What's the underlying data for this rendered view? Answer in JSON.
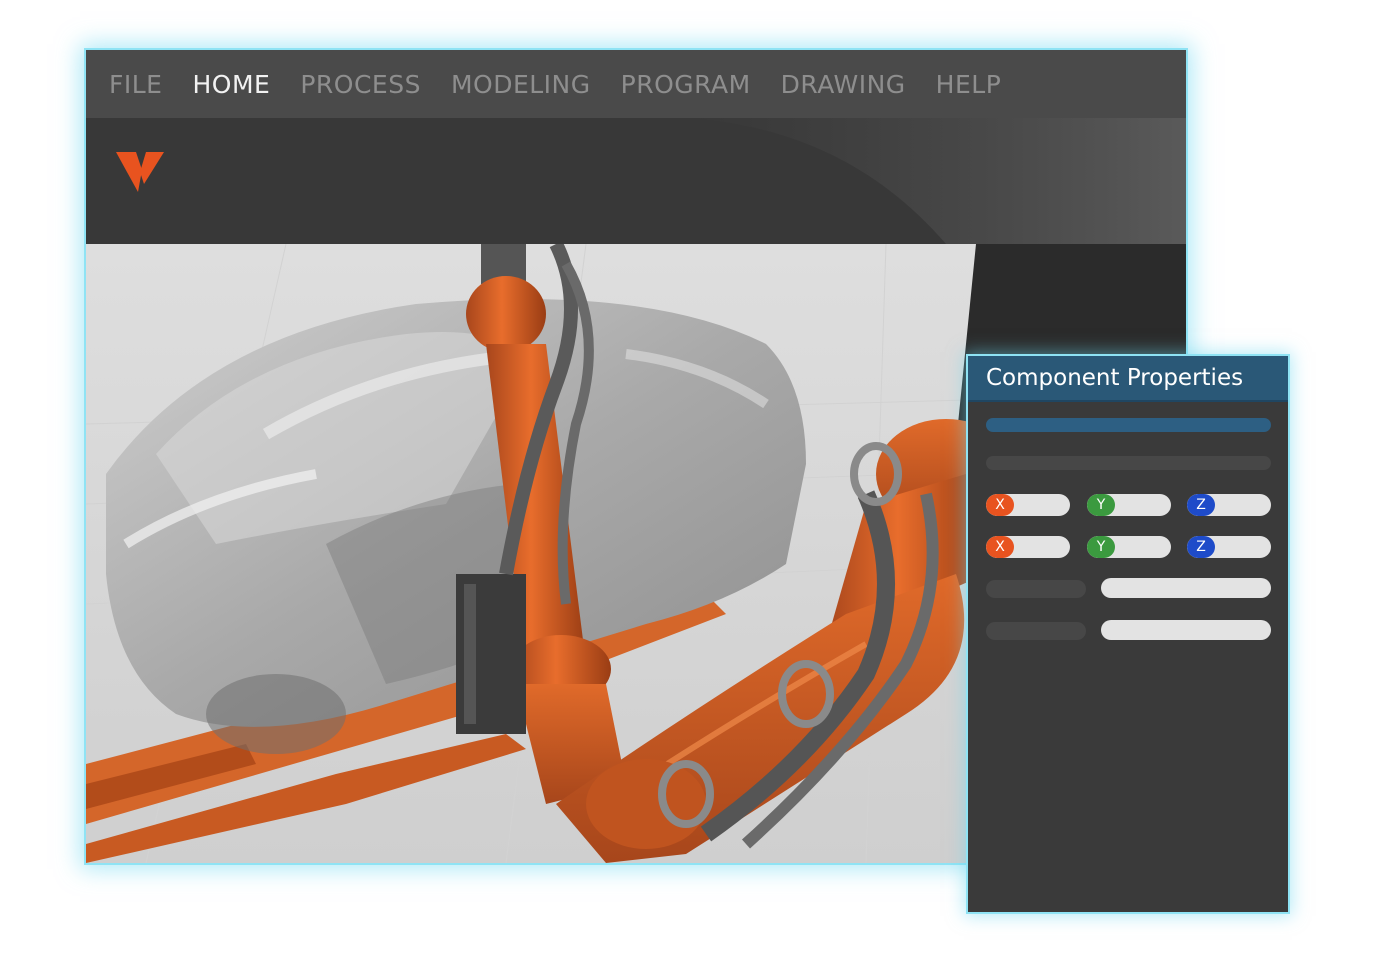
{
  "menu": {
    "items": [
      {
        "label": "FILE"
      },
      {
        "label": "HOME"
      },
      {
        "label": "PROCESS"
      },
      {
        "label": "MODELING"
      },
      {
        "label": "PROGRAM"
      },
      {
        "label": "DRAWING"
      },
      {
        "label": "HELP"
      }
    ],
    "active_item": "HOME"
  },
  "logo": {
    "icon": "v-logo-icon",
    "color": "#e8531f"
  },
  "viewport": {
    "scene": "robot-arm-car-body-3d-scene"
  },
  "component_properties": {
    "title": "Component Properties",
    "rows": [
      {
        "x_label": "X",
        "y_label": "Y",
        "z_label": "Z"
      },
      {
        "x_label": "X",
        "y_label": "Y",
        "z_label": "Z"
      }
    ]
  },
  "colors": {
    "accent": "#e8531f",
    "header": "#2a5877",
    "glow": "#8fe3f4",
    "x_axis": "#e8531f",
    "y_axis": "#3b9a3f",
    "z_axis": "#1e4bc9"
  }
}
